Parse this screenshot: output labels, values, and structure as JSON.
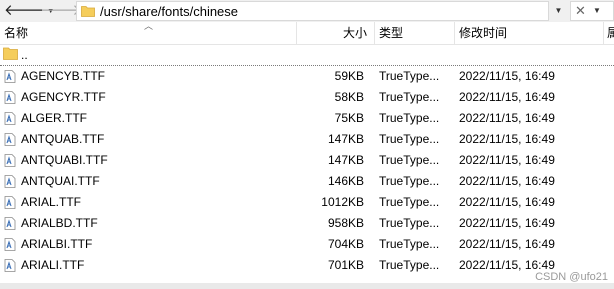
{
  "address": {
    "path": "/usr/share/fonts/chinese"
  },
  "columns": {
    "name": "名称",
    "size": "大小",
    "type": "类型",
    "modified": "修改时间",
    "extra": "属"
  },
  "parent_dir": {
    "label": ".."
  },
  "files": [
    {
      "name": "AGENCYB.TTF",
      "size": "59KB",
      "type": "TrueType...",
      "modified": "2022/11/15, 16:49"
    },
    {
      "name": "AGENCYR.TTF",
      "size": "58KB",
      "type": "TrueType...",
      "modified": "2022/11/15, 16:49"
    },
    {
      "name": "ALGER.TTF",
      "size": "75KB",
      "type": "TrueType...",
      "modified": "2022/11/15, 16:49"
    },
    {
      "name": "ANTQUAB.TTF",
      "size": "147KB",
      "type": "TrueType...",
      "modified": "2022/11/15, 16:49"
    },
    {
      "name": "ANTQUABI.TTF",
      "size": "147KB",
      "type": "TrueType...",
      "modified": "2022/11/15, 16:49"
    },
    {
      "name": "ANTQUAI.TTF",
      "size": "146KB",
      "type": "TrueType...",
      "modified": "2022/11/15, 16:49"
    },
    {
      "name": "ARIAL.TTF",
      "size": "1012KB",
      "type": "TrueType...",
      "modified": "2022/11/15, 16:49"
    },
    {
      "name": "ARIALBD.TTF",
      "size": "958KB",
      "type": "TrueType...",
      "modified": "2022/11/15, 16:49"
    },
    {
      "name": "ARIALBI.TTF",
      "size": "704KB",
      "type": "TrueType...",
      "modified": "2022/11/15, 16:49"
    },
    {
      "name": "ARIALI.TTF",
      "size": "701KB",
      "type": "TrueType...",
      "modified": "2022/11/15, 16:49"
    }
  ],
  "watermark": "CSDN @ufo21",
  "colors": {
    "folder": "#f5cd5b",
    "folder_dark": "#e0b43c",
    "file_icon": "#3b6fb6",
    "header_sep": "#e5e5e5"
  },
  "icons": [
    "back-arrow-icon",
    "forward-arrow-icon",
    "folder-icon",
    "chevron-down-icon",
    "close-icon",
    "font-file-icon"
  ]
}
